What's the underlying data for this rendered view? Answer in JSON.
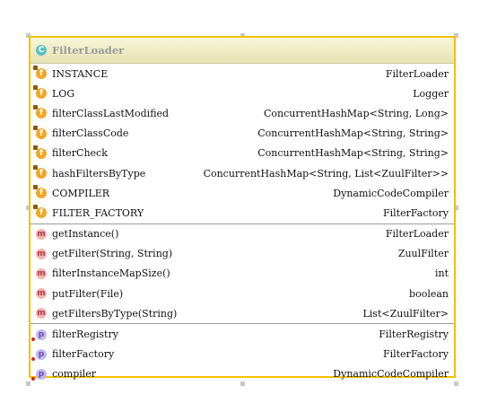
{
  "class_box": {
    "title": "FilterLoader",
    "title_icon": "class-icon",
    "fields": [
      {
        "name": "INSTANCE",
        "type": "FilterLoader"
      },
      {
        "name": "LOG",
        "type": "Logger"
      },
      {
        "name": "filterClassLastModified",
        "type": "ConcurrentHashMap<String, Long>"
      },
      {
        "name": "filterClassCode",
        "type": "ConcurrentHashMap<String, String>"
      },
      {
        "name": "filterCheck",
        "type": "ConcurrentHashMap<String, String>"
      },
      {
        "name": "hashFiltersByType",
        "type": "ConcurrentHashMap<String, List<ZuulFilter>>"
      },
      {
        "name": "COMPILER",
        "type": "DynamicCodeCompiler"
      },
      {
        "name": "FILTER_FACTORY",
        "type": "FilterFactory"
      }
    ],
    "methods": [
      {
        "name": "getInstance()",
        "type": "FilterLoader"
      },
      {
        "name": "getFilter(String, String)",
        "type": "ZuulFilter"
      },
      {
        "name": "filterInstanceMapSize()",
        "type": "int"
      },
      {
        "name": "putFilter(File)",
        "type": "boolean"
      },
      {
        "name": "getFiltersByType(String)",
        "type": "List<ZuulFilter>"
      }
    ],
    "properties": [
      {
        "name": "filterRegistry",
        "type": "FilterRegistry"
      },
      {
        "name": "filterFactory",
        "type": "FilterFactory"
      },
      {
        "name": "compiler",
        "type": "DynamicCodeCompiler"
      }
    ],
    "icon_letters": {
      "class": "C",
      "field": "f",
      "method": "m",
      "property": "p"
    }
  }
}
